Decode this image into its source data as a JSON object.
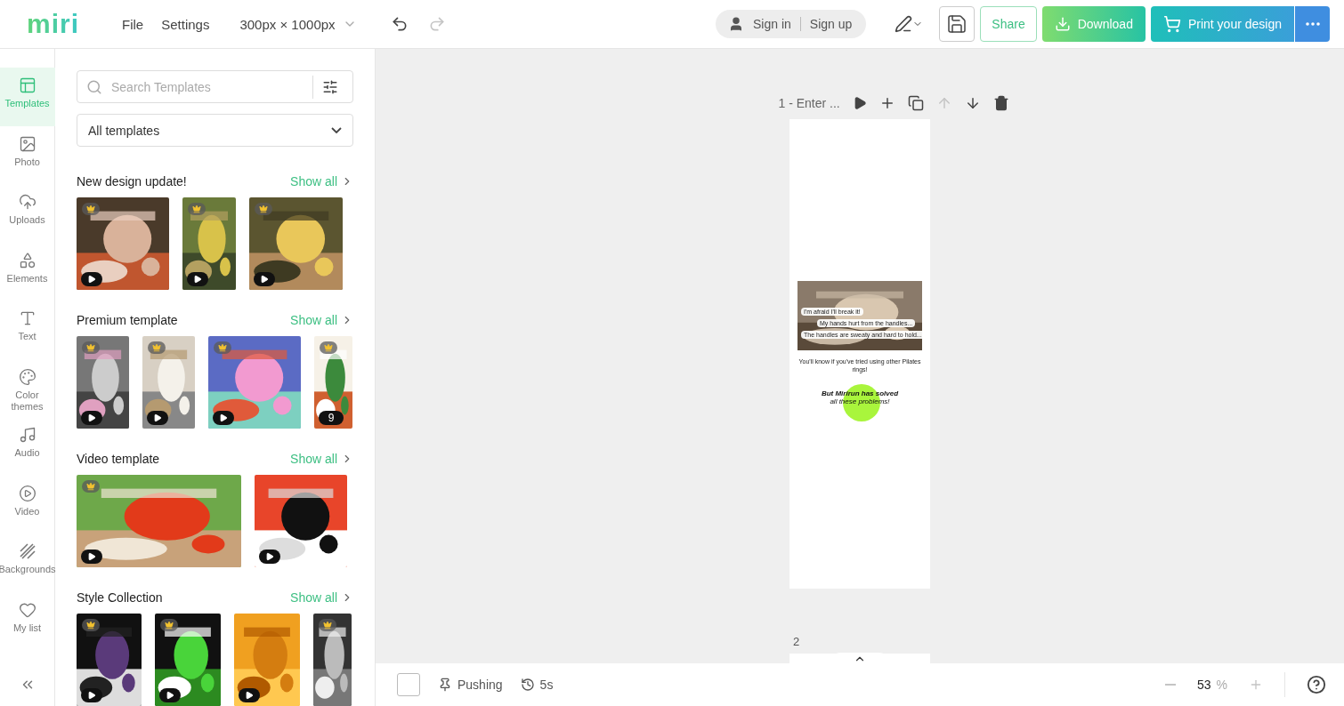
{
  "topbar": {
    "logo": "miri",
    "menus": [
      "File",
      "Settings"
    ],
    "size": "300px × 1000px",
    "undo": {
      "disabled": false
    },
    "redo": {
      "disabled": true
    },
    "sign_in": "Sign in",
    "sign_up": "Sign up",
    "share": "Share",
    "download": "Download",
    "print": "Print your design"
  },
  "rail": [
    {
      "label": "Templates",
      "selected": true
    },
    {
      "label": "Photo",
      "selected": false
    },
    {
      "label": "Uploads",
      "selected": false
    },
    {
      "label": "Elements",
      "selected": false
    },
    {
      "label": "Text",
      "selected": false
    },
    {
      "label": "Color themes",
      "selected": false
    },
    {
      "label": "Audio",
      "selected": false
    },
    {
      "label": "Video",
      "selected": false
    },
    {
      "label": "Backgrounds",
      "selected": false
    },
    {
      "label": "My list",
      "selected": false
    }
  ],
  "panel": {
    "search": {
      "placeholder": "Search Templates"
    },
    "filter": "All templates",
    "sections": [
      {
        "title": "New design update!",
        "show_all": "Show all",
        "thumbs": [
          {
            "premium": true,
            "kind": "video"
          },
          {
            "premium": true,
            "kind": "video"
          },
          {
            "premium": true,
            "kind": "video"
          }
        ]
      },
      {
        "title": "Premium template",
        "show_all": "Show all",
        "thumbs": [
          {
            "premium": true,
            "kind": "video"
          },
          {
            "premium": true,
            "kind": "video"
          },
          {
            "premium": true,
            "kind": "video"
          },
          {
            "premium": true,
            "kind": "pages",
            "count": "9"
          }
        ]
      },
      {
        "title": "Video template",
        "show_all": "Show all",
        "thumbs": [
          {
            "premium": true,
            "kind": "video"
          },
          {
            "premium": false,
            "kind": "video"
          }
        ]
      },
      {
        "title": "Style Collection",
        "show_all": "Show all",
        "thumbs": [
          {
            "premium": true,
            "kind": "video"
          },
          {
            "premium": true,
            "kind": "video"
          },
          {
            "premium": false,
            "kind": "video"
          },
          {
            "premium": true,
            "kind": "still"
          }
        ]
      }
    ]
  },
  "canvas": {
    "page_title": "1 - Enter ...",
    "move_up": {
      "disabled": true
    },
    "move_down": {
      "disabled": false
    },
    "design": {
      "bubbles": [
        "I'm afraid I'll break it!",
        "My hands hurt from the handles...",
        "The handles are sweaty and hard to hold..."
      ],
      "note": "You'll know if you've tried using other Pilates rings!",
      "headline": "But Mirirun has solved",
      "subline": "all these problems!"
    },
    "next_page": "2"
  },
  "status": {
    "autosave": "Pushing",
    "history": "5s",
    "zoom": "53",
    "zoom_unit": "%"
  }
}
